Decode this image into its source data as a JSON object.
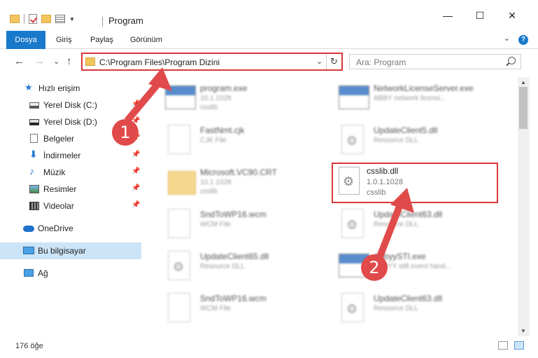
{
  "window": {
    "title": "Program",
    "minimize": "—",
    "maximize": "☐",
    "close": "✕"
  },
  "ribbon": {
    "tabs": [
      "Dosya",
      "Giriş",
      "Paylaş",
      "Görünüm"
    ],
    "help": "?"
  },
  "nav": {
    "back": "←",
    "forward": "→",
    "recent": "⌄",
    "up": "↑",
    "address": "C:\\Program Files\\Program Dizini",
    "refresh": "↻",
    "search_placeholder": "Ara: Program"
  },
  "sidebar": {
    "items": [
      {
        "label": "Hızlı erişim",
        "icon": "star-icon"
      },
      {
        "label": "Yerel Disk (C:)",
        "icon": "drive-icon"
      },
      {
        "label": "Yerel Disk (D:)",
        "icon": "drive-icon"
      },
      {
        "label": "Belgeler",
        "icon": "documents-icon"
      },
      {
        "label": "İndirmeler",
        "icon": "download-icon"
      },
      {
        "label": "Müzik",
        "icon": "music-icon"
      },
      {
        "label": "Resimler",
        "icon": "pictures-icon"
      },
      {
        "label": "Videolar",
        "icon": "videos-icon"
      },
      {
        "label": "OneDrive",
        "icon": "cloud-icon"
      },
      {
        "label": "Bu bilgisayar",
        "icon": "computer-icon"
      },
      {
        "label": "Ağ",
        "icon": "network-icon"
      }
    ]
  },
  "files": [
    {
      "name": "program.exe",
      "line2": "10.1.1028",
      "line3": "csslib",
      "type": "exe"
    },
    {
      "name": "NetworkLicenseServer.exe",
      "line2": "ABBY network licensi...",
      "line3": "",
      "type": "exe"
    },
    {
      "name": "FastNmt.cjk",
      "line2": "CJK File",
      "line3": "",
      "type": "doc"
    },
    {
      "name": "UpdateClient5.dll",
      "line2": "Resource DLL",
      "line3": "",
      "type": "dll"
    },
    {
      "name": "Microsoft.VC90.CRT",
      "line2": "10.1.1028",
      "line3": "csslib",
      "type": "folder"
    },
    {
      "name": "SndToWP16.wcm",
      "line2": "WCM File",
      "line3": "",
      "type": "doc"
    },
    {
      "name": "UpdateClient63.dll",
      "line2": "Resource DLL",
      "line3": "",
      "type": "dll"
    },
    {
      "name": "UpdateClient65.dll",
      "line2": "Resource DLL",
      "line3": "",
      "type": "dll"
    },
    {
      "name": "AbbyySTI.exe",
      "line2": "ABBYY still event hand...",
      "line3": "",
      "type": "exe"
    },
    {
      "name": "SndToWP16.wcm",
      "line2": "WCM File",
      "line3": "",
      "type": "doc"
    },
    {
      "name": "UpdateClient63.dll",
      "line2": "Resource DLL",
      "line3": "",
      "type": "dll"
    }
  ],
  "highlighted": {
    "name": "csslib.dll",
    "version": "1.0.1.1028",
    "description": "csslib"
  },
  "annotations": {
    "step1": "1",
    "step2": "2",
    "color": "#e14a4a"
  },
  "status": {
    "count": "176 öğe"
  }
}
